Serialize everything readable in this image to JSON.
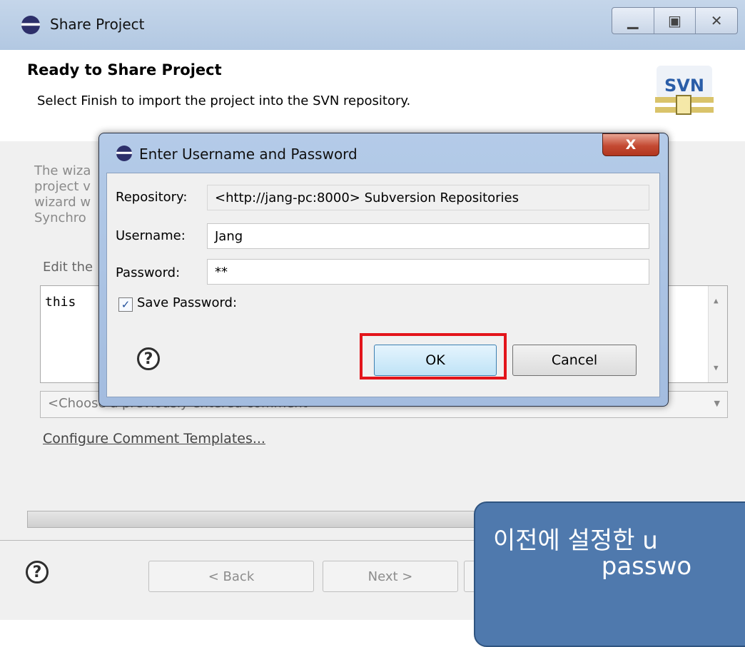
{
  "main_window": {
    "title": "Share Project",
    "header": {
      "title": "Ready to Share Project",
      "description": "Select Finish to import the project into the SVN repository.",
      "logo_text": "SVN"
    },
    "background_text": {
      "line1": "The wiza",
      "line2": "project v",
      "line3": "wizard w",
      "line4": "Synchro",
      "edit_label": "Edit the"
    },
    "comment_text": "this",
    "combo_placeholder": "<Choose a previously entered comment>",
    "configure_link": "Configure Comment Templates...",
    "buttons": {
      "back": "< Back",
      "next": "Next >"
    }
  },
  "dialog": {
    "title": "Enter Username and Password",
    "close_label": "X",
    "repository_label": "Repository:",
    "repository_value": "<http://jang-pc:8000> Subversion Repositories",
    "username_label": "Username:",
    "username_value": "Jang",
    "password_label": "Password:",
    "password_value": "**",
    "save_password_label": "Save Password:",
    "save_password_checked": true,
    "ok_label": "OK",
    "cancel_label": "Cancel"
  },
  "callout": {
    "line1": "이전에 설정한 u",
    "line2": "passwo"
  },
  "colors": {
    "titlebar": "#b8cce4",
    "callout": "#4f79ad",
    "highlight": "#e3151b",
    "close_button": "#c44a33"
  }
}
